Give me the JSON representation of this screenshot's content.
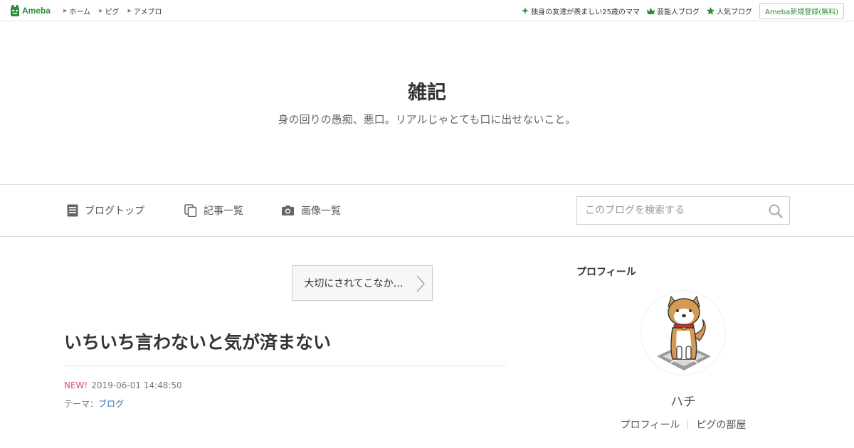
{
  "topbar": {
    "logo_text": "Ameba",
    "nav": [
      {
        "label": "ホーム"
      },
      {
        "label": "ピグ"
      },
      {
        "label": "アメブロ"
      }
    ],
    "right_links": [
      {
        "label": "独身の友達が羨ましい25歳のママ",
        "icon": "sparkle-icon"
      },
      {
        "label": "芸能人ブログ",
        "icon": "crown-icon"
      },
      {
        "label": "人気ブログ",
        "icon": "star-icon"
      }
    ],
    "signup_label": "Ameba新規登録(無料)"
  },
  "header": {
    "title": "雑記",
    "description": "身の回りの愚痴、悪口。リアルじゃとても口に出せないこと。"
  },
  "global_nav": {
    "items": [
      {
        "label": "ブログトップ",
        "icon": "document-icon"
      },
      {
        "label": "記事一覧",
        "icon": "copy-icon"
      },
      {
        "label": "画像一覧",
        "icon": "camera-icon"
      }
    ],
    "search_placeholder": "このブログを検索する"
  },
  "main": {
    "prev_entry_label": "大切にされてこなか…",
    "entry": {
      "title": "いちいち言わないと気が済まない",
      "new_badge": "NEW!",
      "datetime": "2019-06-01 14:48:50",
      "theme_label": "テーマ：",
      "theme_value": "ブログ"
    }
  },
  "sidebar": {
    "heading": "プロフィール",
    "profile_name": "ハチ",
    "links": [
      {
        "label": "プロフィール"
      },
      {
        "label": "ピグの部屋"
      }
    ]
  },
  "colors": {
    "brand_green": "#2d8c3c",
    "new_badge": "#e0428a",
    "link_blue": "#2f6db5"
  }
}
